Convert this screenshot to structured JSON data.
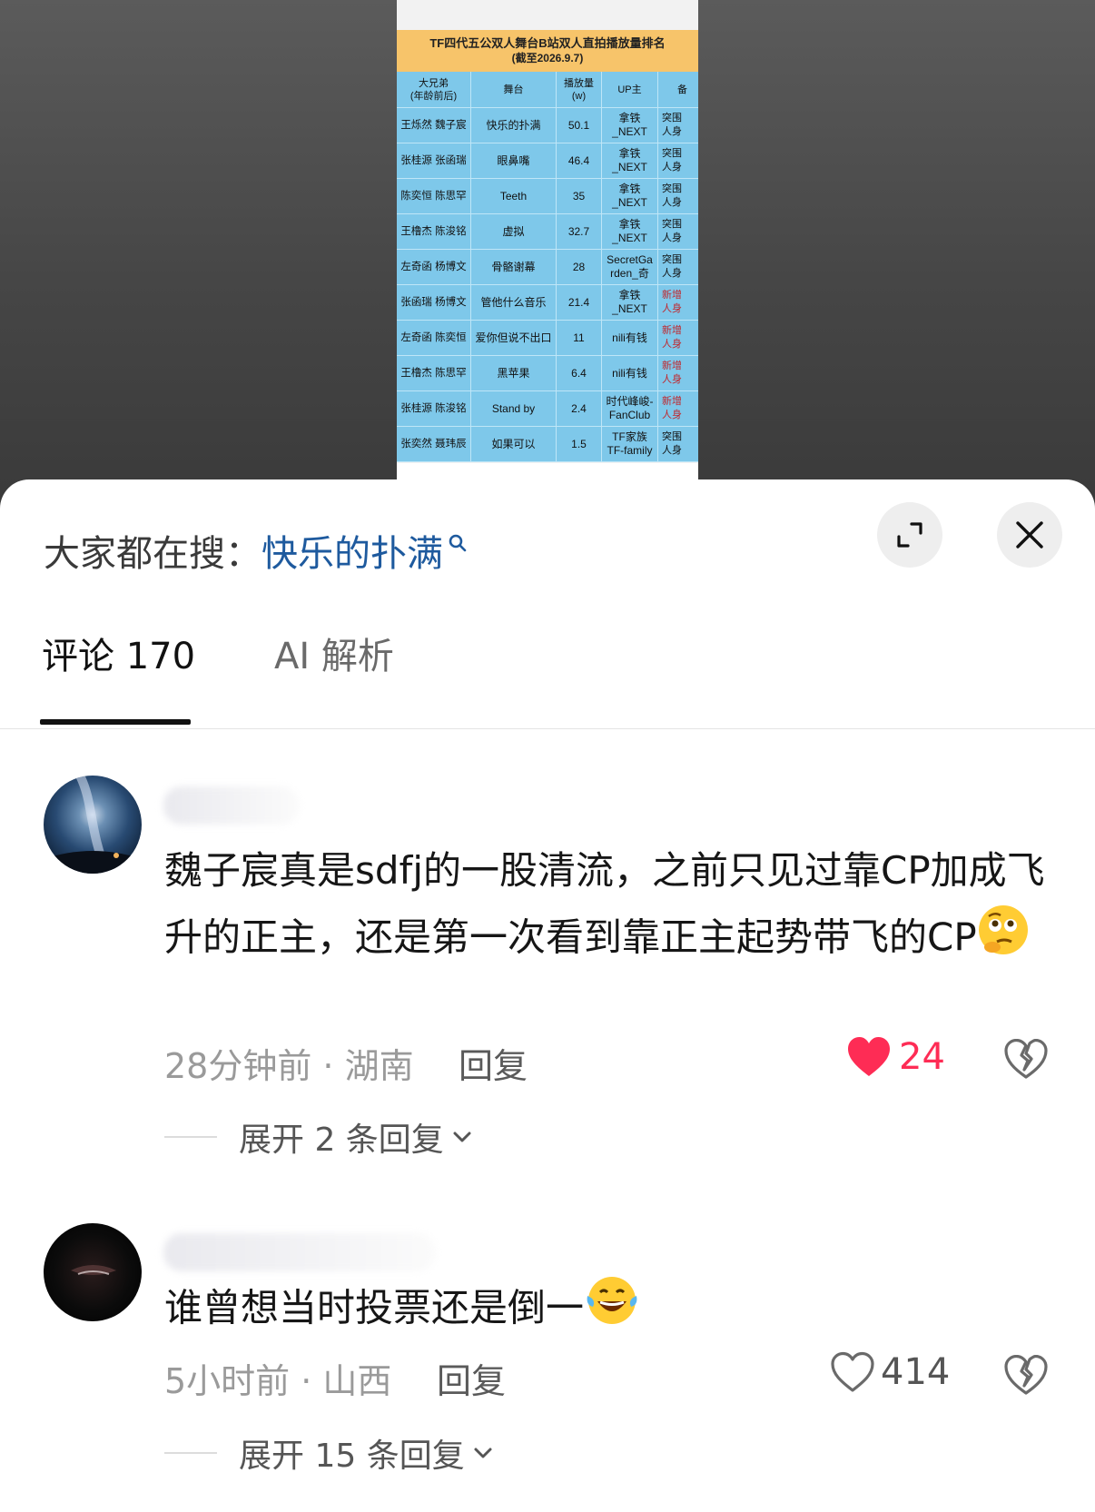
{
  "image": {
    "title_line1": "TF四代五公双人舞台B站双人直拍播放量排名",
    "title_line2": "(截至2026.9.7)",
    "headers": [
      "大兄弟\n(年龄前后)",
      "舞台",
      "播放量\n(w)",
      "UP主",
      "备"
    ],
    "rows": [
      {
        "names": "王烁然 魏子宸",
        "stage": "快乐的扑满",
        "plays": "50.1",
        "up": "拿铁\n_NEXT",
        "note": "突围\n人身",
        "note_red": false
      },
      {
        "names": "张桂源 张函瑞",
        "stage": "眼鼻嘴",
        "plays": "46.4",
        "up": "拿铁\n_NEXT",
        "note": "突围\n人身",
        "note_red": false
      },
      {
        "names": "陈奕恒 陈思罕",
        "stage": "Teeth",
        "plays": "35",
        "up": "拿铁\n_NEXT",
        "note": "突围\n人身",
        "note_red": false
      },
      {
        "names": "王橹杰 陈浚铭",
        "stage": "虚拟",
        "plays": "32.7",
        "up": "拿铁\n_NEXT",
        "note": "突围\n人身",
        "note_red": false
      },
      {
        "names": "左奇函 杨博文",
        "stage": "骨骼谢幕",
        "plays": "28",
        "up": "SecretGa\nrden_奇",
        "note": "突围\n人身",
        "note_red": false
      },
      {
        "names": "张函瑞 杨博文",
        "stage": "管他什么音乐",
        "plays": "21.4",
        "up": "拿铁\n_NEXT",
        "note": "新增\n人身",
        "note_red": true
      },
      {
        "names": "左奇函 陈奕恒",
        "stage": "爱你但说不出口",
        "plays": "11",
        "up": "nili有钱",
        "note": "新增\n人身",
        "note_red": true
      },
      {
        "names": "王橹杰 陈思罕",
        "stage": "黑苹果",
        "plays": "6.4",
        "up": "nili有钱",
        "note": "新增\n人身",
        "note_red": true
      },
      {
        "names": "张桂源 陈浚铭",
        "stage": "Stand by",
        "plays": "2.4",
        "up": "时代峰峻-\nFanClub",
        "note": "新增\n人身",
        "note_red": true
      },
      {
        "names": "张奕然 聂玮辰",
        "stage": "如果可以",
        "plays": "1.5",
        "up": "TF家族\nTF-family",
        "note": "突围\n人身",
        "note_red": false
      }
    ]
  },
  "search": {
    "prefix": "大家都在搜：",
    "term": "快乐的扑满"
  },
  "tabs": {
    "comments": "评论 170",
    "ai": "AI 解析"
  },
  "comments": [
    {
      "text": "魏子宸真是sdfj的一股清流，之前只见过靠CP加成飞升的正主，还是第一次看到靠正主起势带飞的CP",
      "time_loc": "28分钟前 · 湖南",
      "reply": "回复",
      "likes": "24",
      "liked": true,
      "expand": "展开 2 条回复",
      "emoji": "thinking-face-emoji"
    },
    {
      "text": "谁曾想当时投票还是倒一",
      "time_loc": "5小时前 · 山西",
      "reply": "回复",
      "likes": "414",
      "liked": false,
      "expand": "展开 15 条回复",
      "emoji": "laughing-tears-emoji"
    }
  ],
  "colors": {
    "accent_blue": "#1e5a9e",
    "like_red": "#fe2c55",
    "table_cell": "#7ec8ea",
    "table_title": "#f7c46a"
  }
}
